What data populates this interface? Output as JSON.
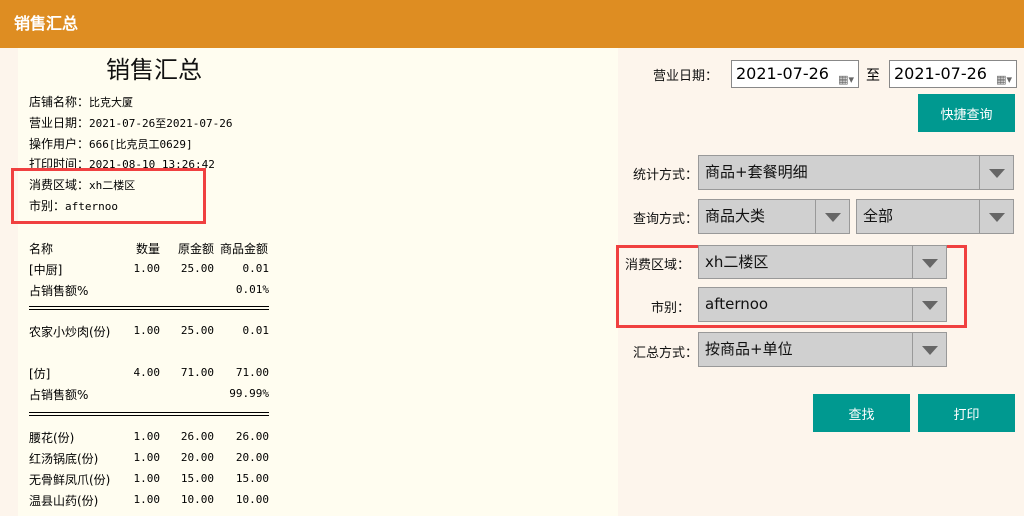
{
  "header": {
    "title": "销售汇总"
  },
  "receipt": {
    "title": "销售汇总",
    "info": [
      {
        "label": "店铺名称：",
        "value": "比克大厦"
      },
      {
        "label": "营业日期：",
        "value": "2021-07-26至2021-07-26"
      },
      {
        "label": "操作用户：",
        "value": "666[比克员工0629]"
      },
      {
        "label": "打印时间：",
        "value": "2021-08-10 13:26:42"
      },
      {
        "label": "消费区域：",
        "value": "xh二楼区"
      },
      {
        "label": "市别：",
        "value": "afternoo"
      }
    ],
    "columns": [
      "名称",
      "数量",
      "原金额",
      "商品金额"
    ],
    "rows": [
      {
        "name": "[中厨]",
        "qty": "1.00",
        "orig": "25.00",
        "amount": "0.01"
      },
      {
        "name": "占销售额%",
        "qty": "",
        "orig": "",
        "amount": "0.01%"
      },
      {
        "name": "农家小炒肉(份)",
        "qty": "1.00",
        "orig": "25.00",
        "amount": "0.01"
      },
      {
        "name": "[仿]",
        "qty": "4.00",
        "orig": "71.00",
        "amount": "71.00"
      },
      {
        "name": "占销售额%",
        "qty": "",
        "orig": "",
        "amount": "99.99%"
      },
      {
        "name": "腰花(份)",
        "qty": "1.00",
        "orig": "26.00",
        "amount": "26.00"
      },
      {
        "name": "红汤锅底(份)",
        "qty": "1.00",
        "orig": "20.00",
        "amount": "20.00"
      },
      {
        "name": "无骨鲜凤爪(份)",
        "qty": "1.00",
        "orig": "15.00",
        "amount": "15.00"
      },
      {
        "name": "温县山药(份)",
        "qty": "1.00",
        "orig": "10.00",
        "amount": "10.00"
      }
    ]
  },
  "form": {
    "date_label": "营业日期：",
    "date_from": "2021-07-26",
    "to_label": "至",
    "date_to": "2021-07-26",
    "quick_query": "快捷查询",
    "stat_label": "统计方式：",
    "stat_value": "商品+套餐明细",
    "query_label": "查询方式：",
    "query_value": "商品大类",
    "query_value2": "全部",
    "area_label": "消费区域：",
    "area_value": "xh二楼区",
    "shift_label": "市别：",
    "shift_value": "afternoo",
    "summary_label": "汇总方式：",
    "summary_value": "按商品+单位",
    "search": "查找",
    "print": "打印"
  },
  "colors": {
    "header": "#de8d22",
    "button": "#009990",
    "highlight": "#f04040"
  }
}
